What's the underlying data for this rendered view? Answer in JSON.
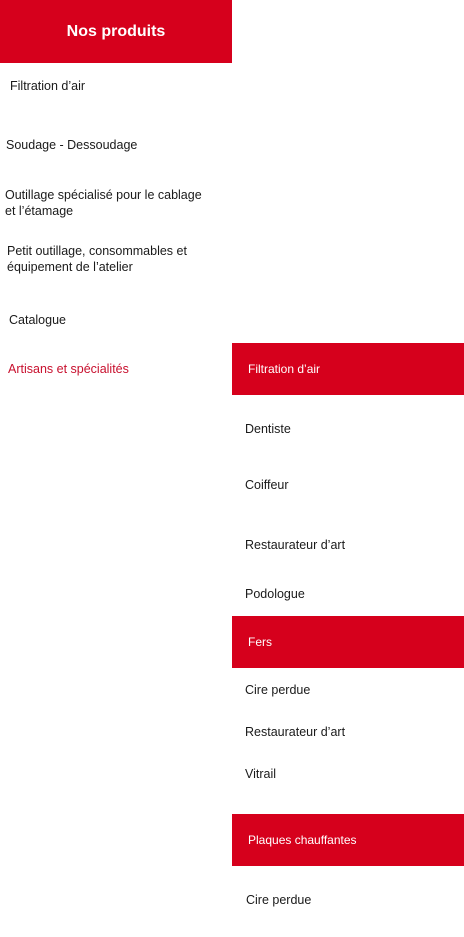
{
  "header": {
    "title": "Nos produits"
  },
  "left_menu": [
    {
      "label": "Filtration d’air"
    },
    {
      "label": "Soudage - Dessoudage"
    },
    {
      "label": "Outillage spécialisé pour le cablage\n et l’étamage"
    },
    {
      "label": " Petit outillage, consommables et\néquipement de l’atelier"
    },
    {
      "label": "Catalogue"
    },
    {
      "label": "Artisans et spécialités",
      "active": true
    }
  ],
  "submenu": {
    "sections": [
      {
        "title": "Filtration d’air",
        "items": [
          "Dentiste",
          "Coiffeur",
          "Restaurateur d’art",
          "Podologue"
        ]
      },
      {
        "title": "Fers",
        "items": [
          "Cire perdue",
          "Restaurateur d’art",
          "Vitrail"
        ]
      },
      {
        "title": "Plaques chauffantes",
        "items": [
          "Cire perdue"
        ]
      }
    ]
  },
  "colors": {
    "accent": "#d6001c",
    "active_text": "#c8102e"
  }
}
